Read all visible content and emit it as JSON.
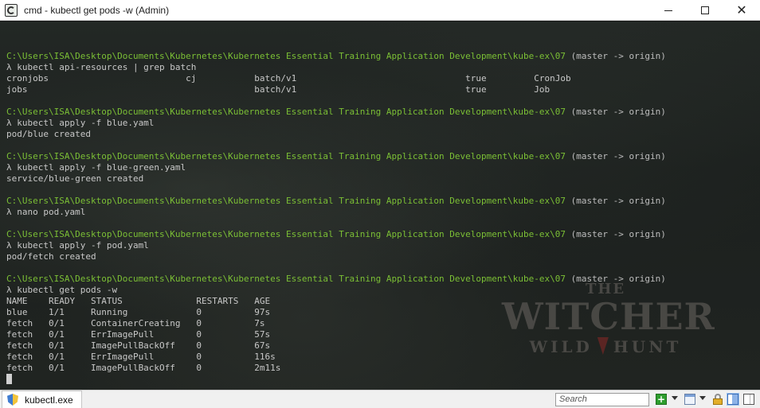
{
  "window": {
    "title": "cmd - kubectl  get pods -w (Admin)",
    "controls": {
      "minimize": "minimize",
      "maximize": "maximize",
      "close": "✕"
    }
  },
  "console": {
    "prompt_path": "C:\\Users\\ISA\\Desktop\\Documents\\Kubernetes\\Kubernetes Essential Training Application Development\\kube-ex\\07",
    "branch": "(master -> origin)",
    "blocks": [
      {
        "command": "λ kubectl api-resources | grep batch",
        "output": [
          "cronjobs                          cj           batch/v1                                true         CronJob",
          "jobs                                           batch/v1                                true         Job"
        ]
      },
      {
        "command": "λ kubectl apply -f blue.yaml",
        "output": [
          "pod/blue created"
        ]
      },
      {
        "command": "λ kubectl apply -f blue-green.yaml",
        "output": [
          "service/blue-green created"
        ]
      },
      {
        "command": "λ nano pod.yaml",
        "output": []
      },
      {
        "command": "λ kubectl apply -f pod.yaml",
        "output": [
          "pod/fetch created"
        ]
      },
      {
        "command": "λ kubectl get pods -w",
        "output": [
          "NAME    READY   STATUS              RESTARTS   AGE",
          "blue    1/1     Running             0          97s",
          "fetch   0/1     ContainerCreating   0          7s",
          "fetch   0/1     ErrImagePull        0          57s",
          "fetch   0/1     ImagePullBackOff    0          67s",
          "fetch   0/1     ErrImagePull        0          116s",
          "fetch   0/1     ImagePullBackOff    0          2m11s"
        ]
      }
    ]
  },
  "wallpaper": {
    "logo_the": "THE",
    "logo_title": "WITCHER",
    "logo_wild": "WILD",
    "logo_hunt": "HUNT"
  },
  "statusbar": {
    "tab_label": "kubectl.exe",
    "search_placeholder": "Search",
    "icons": [
      "shield-icon",
      "plus-icon",
      "dropdown-icon",
      "window-icon",
      "lock-icon",
      "layout-icon"
    ]
  },
  "colors": {
    "prompt_path": "#7bbf35",
    "text": "#c8c8c8",
    "background": "#1f2320"
  }
}
